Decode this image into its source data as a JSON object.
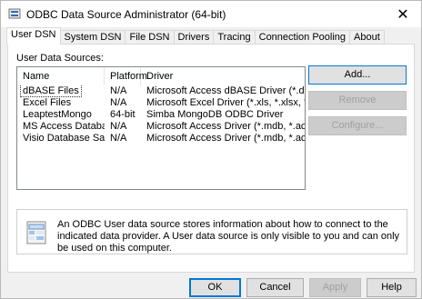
{
  "window": {
    "title": "ODBC Data Source Administrator (64-bit)",
    "close_glyph": "✕"
  },
  "tabs": [
    {
      "label": "User DSN",
      "active": true
    },
    {
      "label": "System DSN"
    },
    {
      "label": "File DSN"
    },
    {
      "label": "Drivers"
    },
    {
      "label": "Tracing"
    },
    {
      "label": "Connection Pooling"
    },
    {
      "label": "About"
    }
  ],
  "panel": {
    "list_label": "User Data Sources:",
    "columns": [
      "Name",
      "Platform",
      "Driver"
    ],
    "rows": [
      {
        "name": "dBASE Files",
        "platform": "N/A",
        "driver": "Microsoft Access dBASE Driver (*.dbf, *.ndx, *."
      },
      {
        "name": "Excel Files",
        "platform": "N/A",
        "driver": "Microsoft Excel Driver (*.xls, *.xlsx, *.xlsm, *.xls"
      },
      {
        "name": "LeaptestMongo",
        "platform": "64-bit",
        "driver": "Simba MongoDB ODBC Driver"
      },
      {
        "name": "MS Access Database",
        "platform": "N/A",
        "driver": "Microsoft Access Driver (*.mdb, *.accdb)"
      },
      {
        "name": "Visio Database Samples",
        "platform": "N/A",
        "driver": "Microsoft Access Driver (*.mdb, *.accdb)"
      }
    ],
    "buttons": {
      "add": "Add...",
      "remove": "Remove",
      "configure": "Configure..."
    },
    "info_text": "An ODBC User data source stores information about how to connect to the indicated data provider.  A User data source is only visible to you and can only be used on this computer."
  },
  "footer": {
    "ok": "OK",
    "cancel": "Cancel",
    "apply": "Apply",
    "help": "Help"
  },
  "colors": {
    "accent": "#0078d7",
    "disabled_text": "#a0a0a0"
  }
}
